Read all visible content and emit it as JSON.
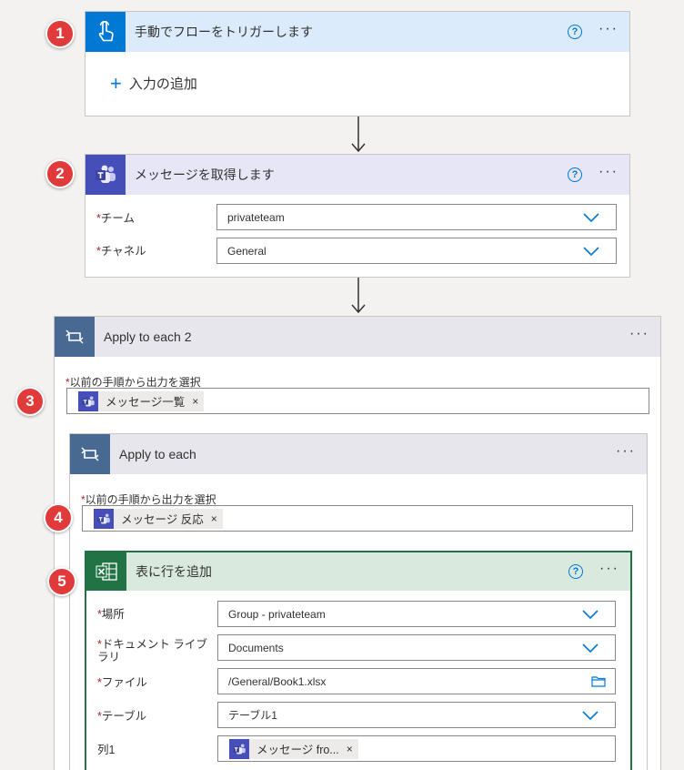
{
  "badges": [
    "1",
    "2",
    "3",
    "4",
    "5"
  ],
  "trigger": {
    "title": "手動でフローをトリガーします",
    "add_input": "入力の追加",
    "help": "?",
    "more": "···",
    "color": "#0078d4"
  },
  "get_messages": {
    "title": "メッセージを取得します",
    "help": "?",
    "more": "···",
    "color": "#464eb8",
    "fields": [
      {
        "required": "*",
        "label": "チーム",
        "value": "privateteam"
      },
      {
        "required": "*",
        "label": "チャネル",
        "value": "General"
      }
    ]
  },
  "apply_each_2": {
    "title": "Apply to each 2",
    "more": "···",
    "field_required": "*",
    "field_label": "以前の手順から出力を選択",
    "token": "メッセージ一覧",
    "token_remove": "×"
  },
  "apply_each": {
    "title": "Apply to each",
    "more": "···",
    "field_required": "*",
    "field_label": "以前の手順から出力を選択",
    "token": "メッセージ 反応",
    "token_remove": "×"
  },
  "add_row": {
    "title": "表に行を追加",
    "help": "?",
    "more": "···",
    "color": "#217346",
    "fields": [
      {
        "required": "*",
        "label": "場所",
        "value": "Group - privateteam"
      },
      {
        "required": "*",
        "label": "ドキュメント ライブラリ",
        "value": "Documents"
      },
      {
        "required": "*",
        "label": "ファイル",
        "value": "/General/Book1.xlsx"
      },
      {
        "required": "*",
        "label": "テーブル",
        "value": "テーブル1"
      },
      {
        "required": "",
        "label": "列1",
        "value": ""
      }
    ],
    "column_token": "メッセージ fro...",
    "token_remove": "×"
  }
}
